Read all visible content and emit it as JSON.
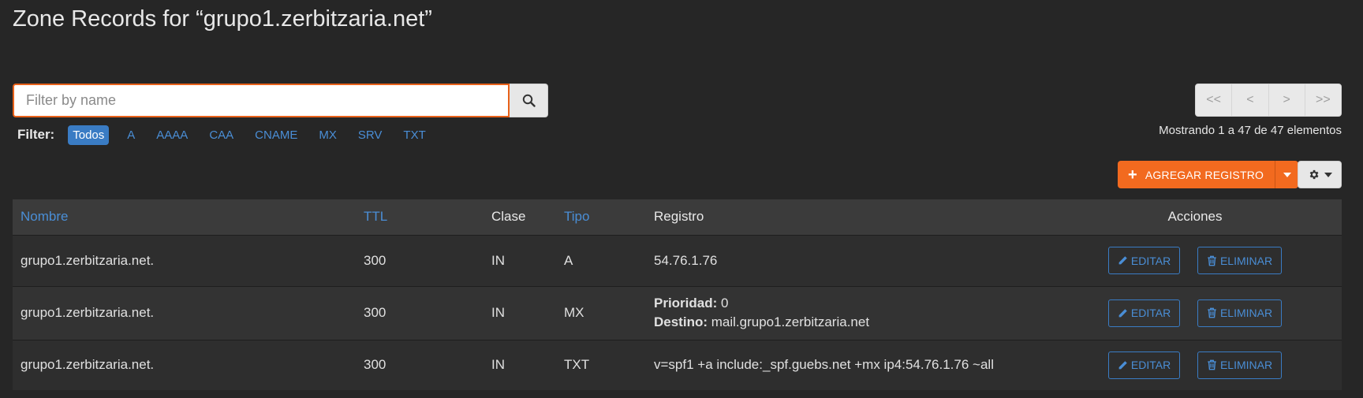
{
  "header": {
    "title": "Zone Records for “grupo1.zerbitzaria.net”"
  },
  "search": {
    "placeholder": "Filter by name",
    "value": "",
    "icon": "search-icon"
  },
  "filter": {
    "label": "Filter:",
    "options": [
      "Todos",
      "A",
      "AAAA",
      "CAA",
      "CNAME",
      "MX",
      "SRV",
      "TXT"
    ],
    "active": "Todos"
  },
  "pager": {
    "first": "<<",
    "prev": "<",
    "next": ">",
    "last": ">>",
    "status": "Mostrando 1 a 47 de 47 elementos"
  },
  "toolbar": {
    "add_label": "AGREGAR REGISTRO",
    "settings_icon": "gear-icon"
  },
  "table": {
    "headers": {
      "name": "Nombre",
      "ttl": "TTL",
      "class": "Clase",
      "type": "Tipo",
      "record": "Registro",
      "actions": "Acciones"
    },
    "rows": [
      {
        "name": "grupo1.zerbitzaria.net.",
        "ttl": "300",
        "class": "IN",
        "type": "A",
        "record": "54.76.1.76"
      },
      {
        "name": "grupo1.zerbitzaria.net.",
        "ttl": "300",
        "class": "IN",
        "type": "MX",
        "priority_label": "Prioridad:",
        "priority": "0",
        "dest_label": "Destino:",
        "dest": "mail.grupo1.zerbitzaria.net"
      },
      {
        "name": "grupo1.zerbitzaria.net.",
        "ttl": "300",
        "class": "IN",
        "type": "TXT",
        "record": "v=spf1 +a include:_spf.guebs.net +mx ip4:54.76.1.76 ~all"
      }
    ],
    "edit_label": "EDITAR",
    "delete_label": "ELIMINAR"
  },
  "colors": {
    "background": "#262626",
    "accent_orange": "#f26a1f",
    "link_blue": "#4a8ed6",
    "active_filter": "#3a7cc4"
  }
}
